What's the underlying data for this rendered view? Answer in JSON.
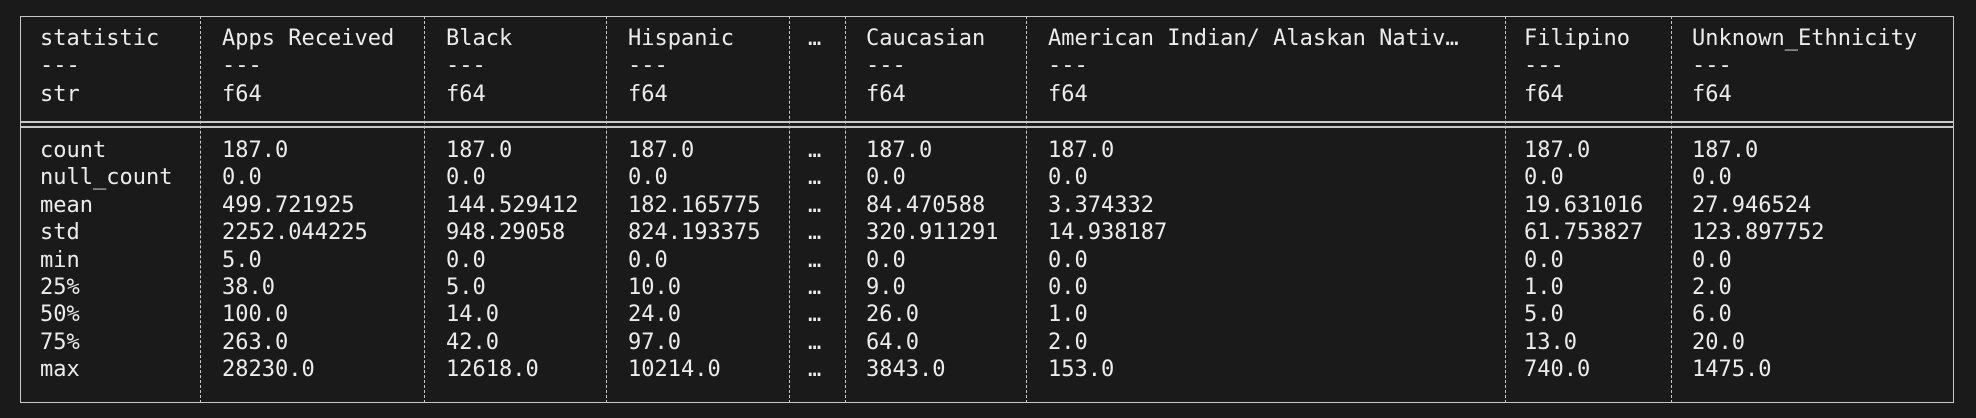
{
  "table": {
    "columns": [
      {
        "name": "statistic",
        "rule": "---",
        "dtype": "str"
      },
      {
        "name": "Apps Received",
        "rule": "---",
        "dtype": "f64"
      },
      {
        "name": "Black",
        "rule": "---",
        "dtype": "f64"
      },
      {
        "name": "Hispanic",
        "rule": "---",
        "dtype": "f64"
      },
      {
        "name": "…",
        "rule": "",
        "dtype": ""
      },
      {
        "name": "Caucasian",
        "rule": "---",
        "dtype": "f64"
      },
      {
        "name": "American Indian/ Alaskan Nativ…",
        "rule": "---",
        "dtype": "f64"
      },
      {
        "name": "Filipino",
        "rule": "---",
        "dtype": "f64"
      },
      {
        "name": "Unknown_Ethnicity",
        "rule": "---",
        "dtype": "f64"
      }
    ],
    "rows": [
      [
        "count",
        "187.0",
        "187.0",
        "187.0",
        "…",
        "187.0",
        "187.0",
        "187.0",
        "187.0"
      ],
      [
        "null_count",
        "0.0",
        "0.0",
        "0.0",
        "…",
        "0.0",
        "0.0",
        "0.0",
        "0.0"
      ],
      [
        "mean",
        "499.721925",
        "144.529412",
        "182.165775",
        "…",
        "84.470588",
        "3.374332",
        "19.631016",
        "27.946524"
      ],
      [
        "std",
        "2252.044225",
        "948.29058",
        "824.193375",
        "…",
        "320.911291",
        "14.938187",
        "61.753827",
        "123.897752"
      ],
      [
        "min",
        "5.0",
        "0.0",
        "0.0",
        "…",
        "0.0",
        "0.0",
        "0.0",
        "0.0"
      ],
      [
        "25%",
        "38.0",
        "5.0",
        "10.0",
        "…",
        "9.0",
        "0.0",
        "1.0",
        "2.0"
      ],
      [
        "50%",
        "100.0",
        "14.0",
        "24.0",
        "…",
        "26.0",
        "1.0",
        "5.0",
        "6.0"
      ],
      [
        "75%",
        "263.0",
        "42.0",
        "97.0",
        "…",
        "64.0",
        "2.0",
        "13.0",
        "20.0"
      ],
      [
        "max",
        "28230.0",
        "12618.0",
        "10214.0",
        "…",
        "3843.0",
        "153.0",
        "740.0",
        "1475.0"
      ]
    ]
  }
}
